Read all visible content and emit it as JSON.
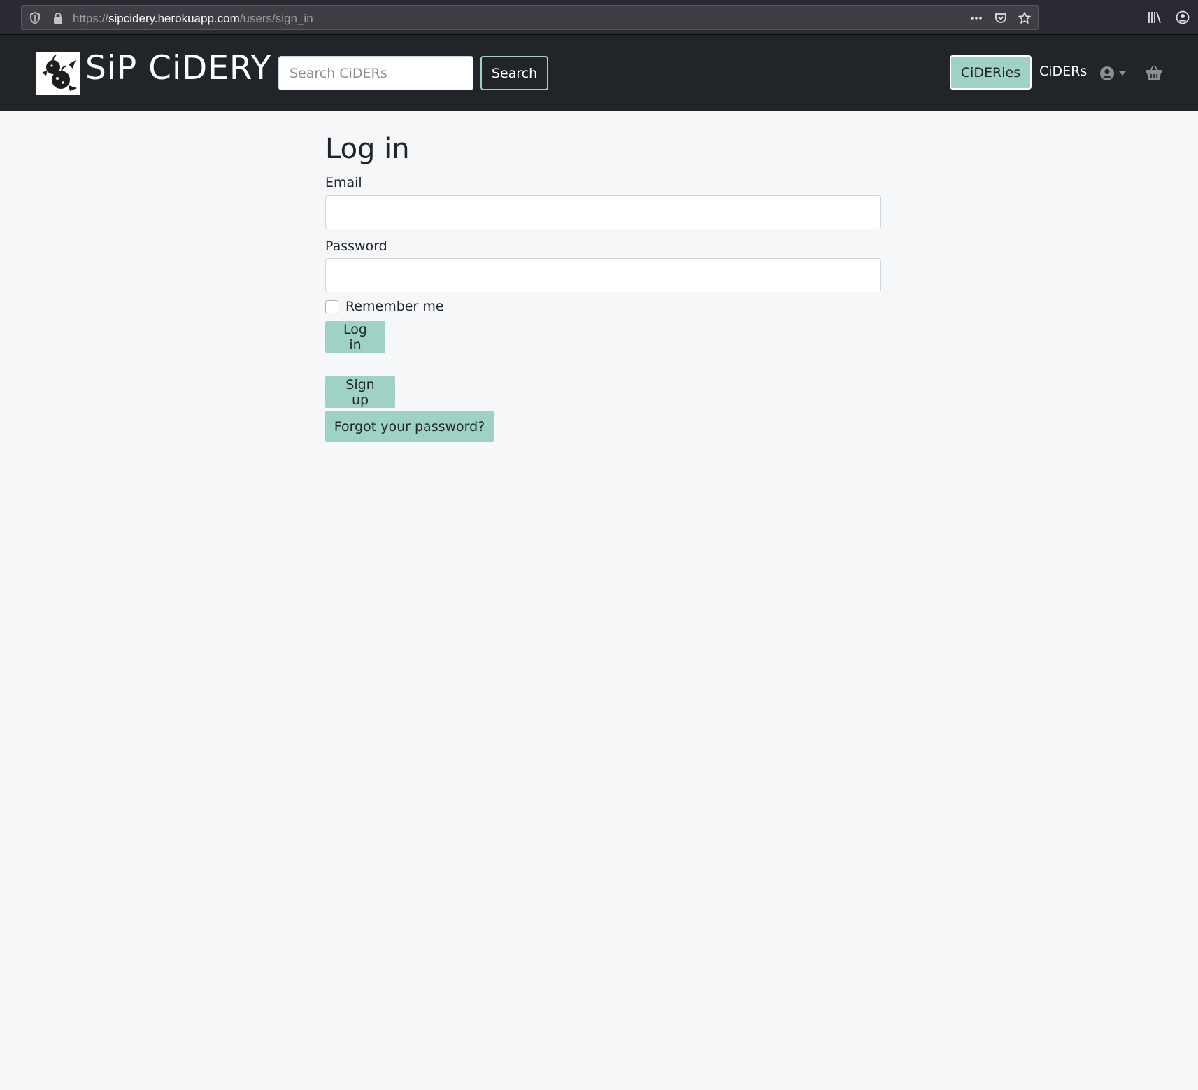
{
  "browser": {
    "url_scheme": "https://",
    "url_host": "sipcidery.herokuapp.com",
    "url_path": "/users/sign_in"
  },
  "navbar": {
    "brand": "SiP CiDERY",
    "search_placeholder": "Search CiDERs",
    "search_button": "Search",
    "links": {
      "cideries": "CiDERies",
      "ciders": "CiDERs"
    },
    "icons": {
      "user": "user-circle-icon",
      "cart": "basket-icon"
    }
  },
  "login": {
    "title": "Log in",
    "email_label": "Email",
    "email_value": "",
    "password_label": "Password",
    "password_value": "",
    "remember_label": "Remember me",
    "remember_checked": false,
    "submit_label": "Log in",
    "signup_label": "Sign up",
    "forgot_label": "Forgot your password?"
  },
  "colors": {
    "accent": "#9ed2c6",
    "navbar_bg": "#212529",
    "page_bg": "#f6f7f9"
  }
}
